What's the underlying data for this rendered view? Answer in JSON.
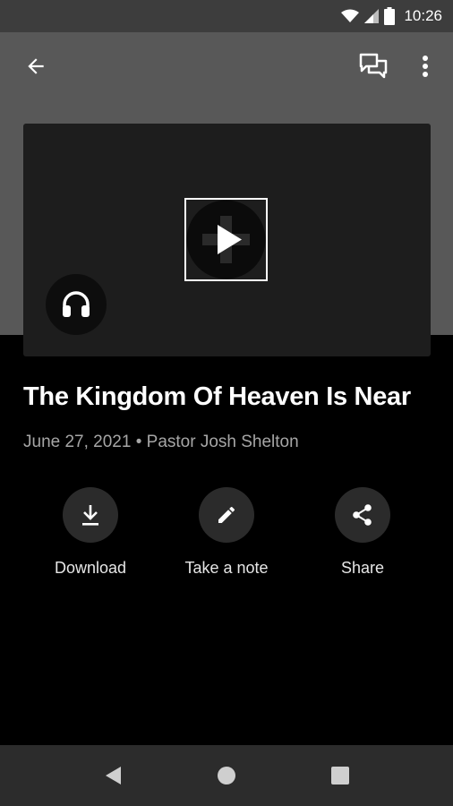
{
  "status_bar": {
    "time": "10:26",
    "icons": [
      "wifi-icon",
      "cell-signal-icon",
      "battery-icon"
    ]
  },
  "app_bar": {
    "back_icon": "arrow-left-icon",
    "actions": [
      "chat-bubbles-icon",
      "more-vert-icon"
    ]
  },
  "media": {
    "play_icon": "play-icon",
    "audio_icon": "headphones-icon"
  },
  "sermon": {
    "title": "The Kingdom Of Heaven Is Near",
    "meta": "June 27, 2021 • Pastor Josh Shelton"
  },
  "actions": [
    {
      "label": "Download",
      "icon": "download-icon"
    },
    {
      "label": "Take a note",
      "icon": "pencil-icon"
    },
    {
      "label": "Share",
      "icon": "share-icon"
    }
  ],
  "nav_bar": {
    "buttons": [
      "nav-back-icon",
      "nav-home-icon",
      "nav-recents-icon"
    ]
  },
  "colors": {
    "header_gray": "#585858",
    "background": "#000000",
    "card": "#1d1d1d",
    "action_circle": "#2b2b2b",
    "meta_text": "#a6a6a6"
  }
}
